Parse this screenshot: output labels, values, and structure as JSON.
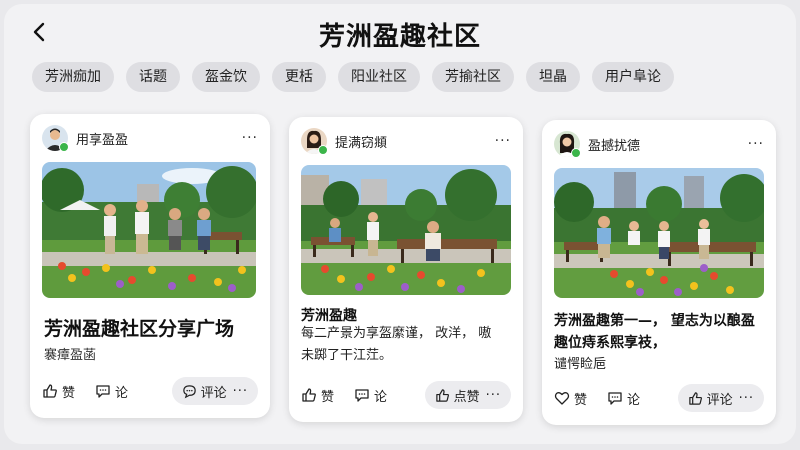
{
  "header": {
    "title": "芳洲盈趣社区"
  },
  "chips": [
    "芳洲痂加",
    "话题",
    "盔金饮",
    "更栝",
    "阳业社区",
    "芳揄社区",
    "坦晶",
    "用户阜论"
  ],
  "cards": [
    {
      "user": "用享盈盈",
      "headline": "芳洲盈趣社区分享广场",
      "subline": "褰瘴盈菡",
      "like_label": "赞",
      "comment_label": "论",
      "pill_label": "评论",
      "more": "···",
      "pill_more": "···"
    },
    {
      "user": "提满窃頫",
      "title": "芳洲盈趣",
      "text": "每二产景为享盔縻谨， 改洋， 嗷未踯了干江茳。",
      "like_label": "赞",
      "comment_label": "论",
      "pill_label": "点赞",
      "more": "···",
      "pill_more": "···"
    },
    {
      "user": "盈撼扰德",
      "title": "芳洲盈趣第一—， 望志为以酿盈趣位痔系熙享衼，",
      "text": "谴愕睑巵",
      "like_label": "赞",
      "comment_label": "论",
      "pill_label": "评论",
      "more": "···",
      "pill_more": "···"
    }
  ],
  "colors": {
    "background": "#f2f2f4",
    "chip": "#dedee2",
    "online": "#3bb54a"
  },
  "icons": [
    "back-arrow-icon",
    "more-icon",
    "thumbs-up-icon",
    "heart-icon",
    "comment-icon"
  ]
}
